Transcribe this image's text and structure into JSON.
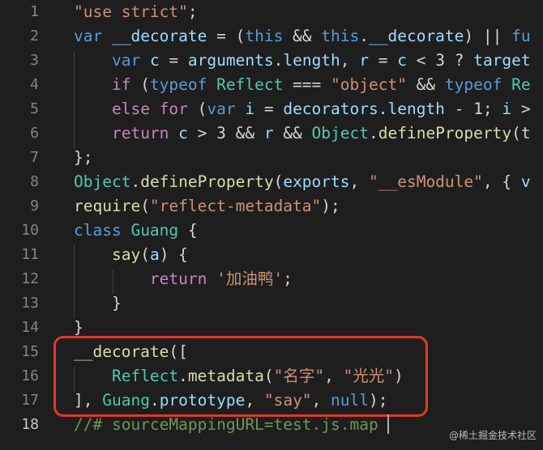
{
  "editor": {
    "lines": [
      {
        "num": "1",
        "tokens": [
          {
            "t": "str",
            "v": "\"use strict\""
          },
          {
            "t": "op",
            "v": ";"
          }
        ]
      },
      {
        "num": "2",
        "tokens": [
          {
            "t": "kw",
            "v": "var "
          },
          {
            "t": "var",
            "v": "__decorate"
          },
          {
            "t": "op",
            "v": " = ("
          },
          {
            "t": "kw",
            "v": "this"
          },
          {
            "t": "op",
            "v": " && "
          },
          {
            "t": "kw",
            "v": "this"
          },
          {
            "t": "op",
            "v": "."
          },
          {
            "t": "var",
            "v": "__decorate"
          },
          {
            "t": "op",
            "v": ") || "
          },
          {
            "t": "kw",
            "v": "fu"
          }
        ]
      },
      {
        "num": "3",
        "tokens": [
          {
            "t": "op",
            "v": "    "
          },
          {
            "t": "kw",
            "v": "var "
          },
          {
            "t": "var",
            "v": "c"
          },
          {
            "t": "op",
            "v": " = "
          },
          {
            "t": "var",
            "v": "arguments"
          },
          {
            "t": "op",
            "v": "."
          },
          {
            "t": "var",
            "v": "length"
          },
          {
            "t": "op",
            "v": ", "
          },
          {
            "t": "var",
            "v": "r"
          },
          {
            "t": "op",
            "v": " = "
          },
          {
            "t": "var",
            "v": "c"
          },
          {
            "t": "op",
            "v": " < 3 ? "
          },
          {
            "t": "var",
            "v": "target"
          }
        ]
      },
      {
        "num": "4",
        "tokens": [
          {
            "t": "op",
            "v": "    "
          },
          {
            "t": "ctl",
            "v": "if"
          },
          {
            "t": "op",
            "v": " ("
          },
          {
            "t": "kw",
            "v": "typeof "
          },
          {
            "t": "cls",
            "v": "Reflect"
          },
          {
            "t": "op",
            "v": " === "
          },
          {
            "t": "str",
            "v": "\"object\""
          },
          {
            "t": "op",
            "v": " && "
          },
          {
            "t": "kw",
            "v": "typeof "
          },
          {
            "t": "cls",
            "v": "Re"
          }
        ]
      },
      {
        "num": "5",
        "tokens": [
          {
            "t": "op",
            "v": "    "
          },
          {
            "t": "ctl",
            "v": "else for"
          },
          {
            "t": "op",
            "v": " ("
          },
          {
            "t": "kw",
            "v": "var "
          },
          {
            "t": "var",
            "v": "i"
          },
          {
            "t": "op",
            "v": " = "
          },
          {
            "t": "var",
            "v": "decorators"
          },
          {
            "t": "op",
            "v": "."
          },
          {
            "t": "var",
            "v": "length"
          },
          {
            "t": "op",
            "v": " - 1; "
          },
          {
            "t": "var",
            "v": "i"
          },
          {
            "t": "op",
            "v": " >"
          }
        ]
      },
      {
        "num": "6",
        "tokens": [
          {
            "t": "op",
            "v": "    "
          },
          {
            "t": "ctl",
            "v": "return "
          },
          {
            "t": "var",
            "v": "c"
          },
          {
            "t": "op",
            "v": " > 3 && "
          },
          {
            "t": "var",
            "v": "r"
          },
          {
            "t": "op",
            "v": " && "
          },
          {
            "t": "cls",
            "v": "Object"
          },
          {
            "t": "op",
            "v": "."
          },
          {
            "t": "fn",
            "v": "defineProperty"
          },
          {
            "t": "op",
            "v": "(t"
          }
        ]
      },
      {
        "num": "7",
        "tokens": [
          {
            "t": "op",
            "v": "};"
          }
        ]
      },
      {
        "num": "8",
        "tokens": [
          {
            "t": "cls",
            "v": "Object"
          },
          {
            "t": "op",
            "v": "."
          },
          {
            "t": "fn",
            "v": "defineProperty"
          },
          {
            "t": "op",
            "v": "("
          },
          {
            "t": "var",
            "v": "exports"
          },
          {
            "t": "op",
            "v": ", "
          },
          {
            "t": "str",
            "v": "\"__esModule\""
          },
          {
            "t": "op",
            "v": ", { "
          },
          {
            "t": "var",
            "v": "v"
          }
        ]
      },
      {
        "num": "9",
        "tokens": [
          {
            "t": "fn",
            "v": "require"
          },
          {
            "t": "op",
            "v": "("
          },
          {
            "t": "str",
            "v": "\"reflect-metadata\""
          },
          {
            "t": "op",
            "v": ");"
          }
        ]
      },
      {
        "num": "10",
        "tokens": [
          {
            "t": "kw",
            "v": "class "
          },
          {
            "t": "cls",
            "v": "Guang"
          },
          {
            "t": "op",
            "v": " {"
          }
        ]
      },
      {
        "num": "11",
        "tokens": [
          {
            "t": "op",
            "v": "    "
          },
          {
            "t": "fn",
            "v": "say"
          },
          {
            "t": "op",
            "v": "("
          },
          {
            "t": "var",
            "v": "a"
          },
          {
            "t": "op",
            "v": ") {"
          }
        ]
      },
      {
        "num": "12",
        "tokens": [
          {
            "t": "op",
            "v": "        "
          },
          {
            "t": "ctl",
            "v": "return "
          },
          {
            "t": "str",
            "v": "'加油鸭'"
          },
          {
            "t": "op",
            "v": ";"
          }
        ]
      },
      {
        "num": "13",
        "tokens": [
          {
            "t": "op",
            "v": "    }"
          }
        ]
      },
      {
        "num": "14",
        "tokens": [
          {
            "t": "op",
            "v": "}"
          }
        ]
      },
      {
        "num": "15",
        "tokens": [
          {
            "t": "fn",
            "v": "__decorate"
          },
          {
            "t": "op",
            "v": "(["
          }
        ]
      },
      {
        "num": "16",
        "tokens": [
          {
            "t": "op",
            "v": "    "
          },
          {
            "t": "cls",
            "v": "Reflect"
          },
          {
            "t": "op",
            "v": "."
          },
          {
            "t": "fn",
            "v": "metadata"
          },
          {
            "t": "op",
            "v": "("
          },
          {
            "t": "str",
            "v": "\"名字\""
          },
          {
            "t": "op",
            "v": ", "
          },
          {
            "t": "str",
            "v": "\"光光\""
          },
          {
            "t": "op",
            "v": ")"
          }
        ]
      },
      {
        "num": "17",
        "tokens": [
          {
            "t": "op",
            "v": "], "
          },
          {
            "t": "cls",
            "v": "Guang"
          },
          {
            "t": "op",
            "v": "."
          },
          {
            "t": "var",
            "v": "prototype"
          },
          {
            "t": "op",
            "v": ", "
          },
          {
            "t": "str",
            "v": "\"say\""
          },
          {
            "t": "op",
            "v": ", "
          },
          {
            "t": "kw",
            "v": "null"
          },
          {
            "t": "op",
            "v": ");"
          }
        ]
      },
      {
        "num": "18",
        "active": true,
        "tokens": [
          {
            "t": "cmt",
            "v": "//# sourceMappingURL=test.js.map"
          }
        ]
      }
    ],
    "highlight_color": "#e2372a"
  },
  "watermark": "@稀土掘金技术社区"
}
